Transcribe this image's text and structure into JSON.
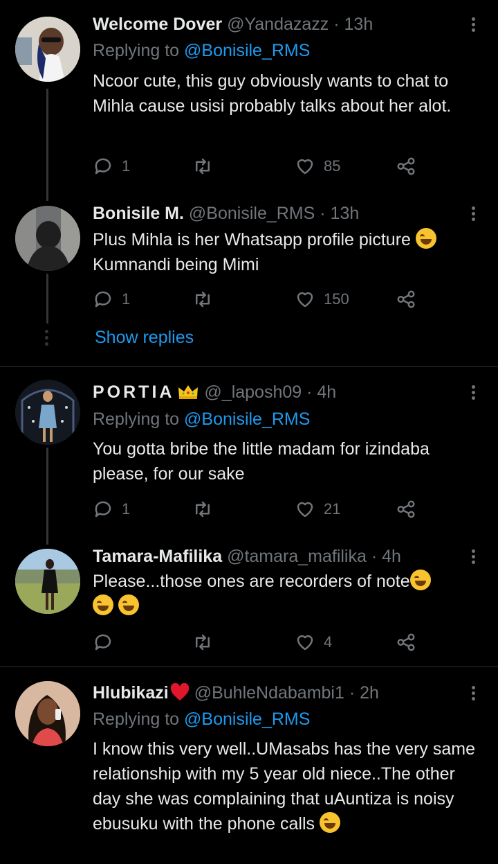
{
  "tweets": [
    {
      "name": "Welcome Dover",
      "handle": "@Yandazazz",
      "dot": "·",
      "time": "13h",
      "replying_prefix": "Replying to",
      "replying_to": "@Bonisile_RMS",
      "text": "Ncoor cute, this guy obviously wants to chat to Mihla cause usisi probably talks about her alot.",
      "replies": "1",
      "retweets": "",
      "likes": "85"
    },
    {
      "name": "Bonisile M.",
      "handle": "@Bonisile_RMS",
      "dot": "·",
      "time": "13h",
      "text_line1": "Plus Mihla is her Whatsapp profile picture",
      "text_line2": "Kumnandi being Mimi",
      "replies": "1",
      "retweets": "",
      "likes": "150"
    },
    {
      "name": "PORTIA",
      "handle": "@_laposh09",
      "dot": "·",
      "time": "4h",
      "replying_prefix": "Replying to",
      "replying_to": "@Bonisile_RMS",
      "text": "You gotta bribe the little madam for izindaba please, for our sake",
      "replies": "1",
      "retweets": "",
      "likes": "21"
    },
    {
      "name": "Tamara-Mafilika",
      "handle": "@tamara_mafilika",
      "dot": "·",
      "time": "4h",
      "text": "Please...those ones are recorders of note",
      "replies": "",
      "retweets": "",
      "likes": "4"
    },
    {
      "name": "Hlubikazi",
      "handle": "@BuhleNdabambi1",
      "dot": "·",
      "time": "2h",
      "replying_prefix": "Replying to",
      "replying_to": "@Bonisile_RMS",
      "text": "I know this very well..UMasabs has the very same relationship with my 5 year old niece..The other day she was complaining that uAuntiza is noisy ebusuku with the phone calls"
    }
  ],
  "show_replies": "Show replies",
  "colors": {
    "background": "#000000",
    "accent": "#1d9bf0",
    "muted": "#71767b",
    "text": "#e7e9ea"
  },
  "icons": [
    "reply-icon",
    "retweet-icon",
    "like-icon",
    "share-icon",
    "more-icon",
    "laughing-emoji-icon",
    "crown-emoji-icon",
    "red-heart-emoji-icon"
  ]
}
